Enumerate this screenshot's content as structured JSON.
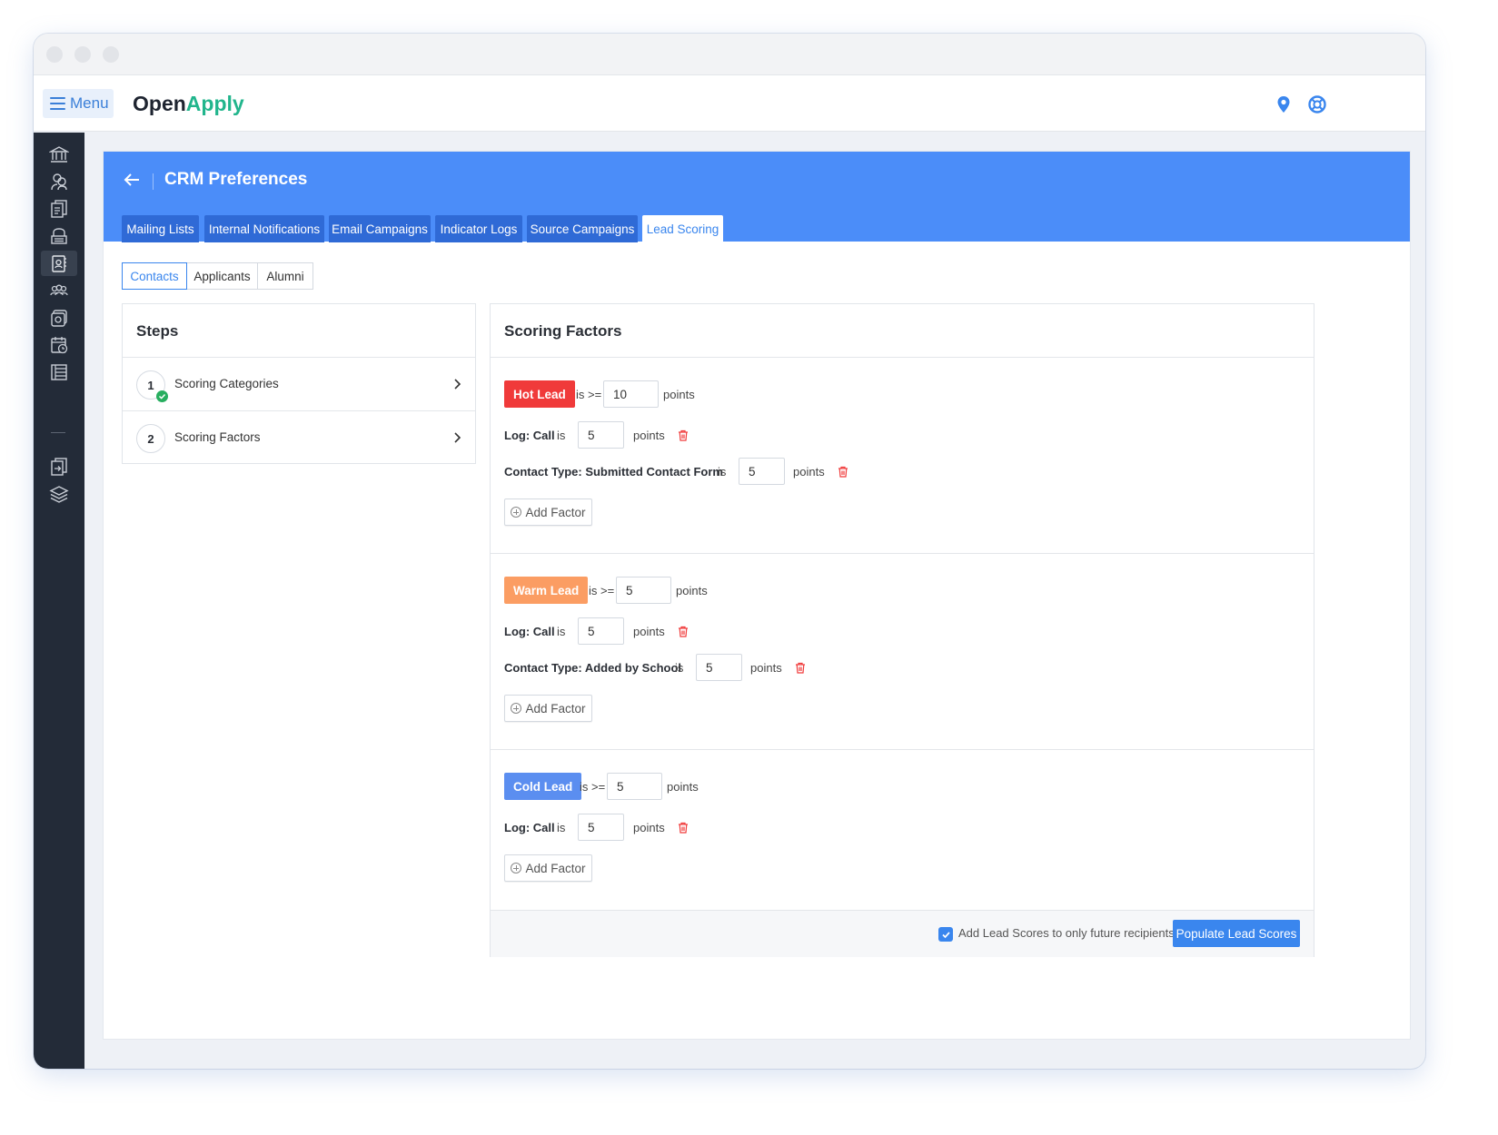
{
  "app": {
    "menu_label": "Menu",
    "logo_part1": "Open",
    "logo_part2": "Apply"
  },
  "sidebar": {
    "icons": [
      "bank-icon",
      "users-icon",
      "documents-icon",
      "inbox-icon",
      "contacts-icon",
      "groups-icon",
      "camera-icon",
      "calendar-icon",
      "list-icon",
      "export-icon",
      "layers-icon"
    ],
    "active_item": "contacts-icon"
  },
  "page": {
    "title": "CRM Preferences",
    "tabs": [
      {
        "label": "Mailing Lists"
      },
      {
        "label": "Internal Notifications"
      },
      {
        "label": "Email Campaigns"
      },
      {
        "label": "Indicator Logs"
      },
      {
        "label": "Source Campaigns"
      },
      {
        "label": "Lead Scoring"
      }
    ],
    "active_tab": "Lead Scoring",
    "segments": [
      {
        "label": "Contacts"
      },
      {
        "label": "Applicants"
      },
      {
        "label": "Alumni"
      }
    ],
    "active_segment": "Contacts"
  },
  "steps": {
    "title": "Steps",
    "items": [
      {
        "number": "1",
        "label": "Scoring Categories",
        "completed": true
      },
      {
        "number": "2",
        "label": "Scoring Factors",
        "completed": false
      }
    ]
  },
  "scoring": {
    "title": "Scoring Factors",
    "threshold_op": "is >=",
    "is_label": "is",
    "points_label": "points",
    "add_factor_label": "Add Factor",
    "groups": [
      {
        "name": "Hot Lead",
        "color": "#f03a3a",
        "threshold": "10",
        "factors": [
          {
            "label": "Log: Call",
            "value": "5"
          },
          {
            "label": "Contact Type: Submitted Contact Form",
            "value": "5"
          }
        ]
      },
      {
        "name": "Warm Lead",
        "color": "#fb9d63",
        "threshold": "5",
        "factors": [
          {
            "label": "Log: Call",
            "value": "5"
          },
          {
            "label": "Contact Type: Added by School",
            "value": "5"
          }
        ]
      },
      {
        "name": "Cold Lead",
        "color": "#5b8ef0",
        "threshold": "5",
        "factors": [
          {
            "label": "Log: Call",
            "value": "5"
          }
        ]
      }
    ],
    "future_checkbox_label": "Add Lead Scores to only future recipients",
    "future_checkbox_checked": true,
    "populate_button": "Populate Lead Scores"
  },
  "colors": {
    "accent": "#3a86ee",
    "banner": "#4b8df9",
    "tab_bg": "#2f6ad6",
    "sidebar_bg": "#232b38",
    "brand_green": "#21b58c",
    "danger": "#f03a3a"
  }
}
